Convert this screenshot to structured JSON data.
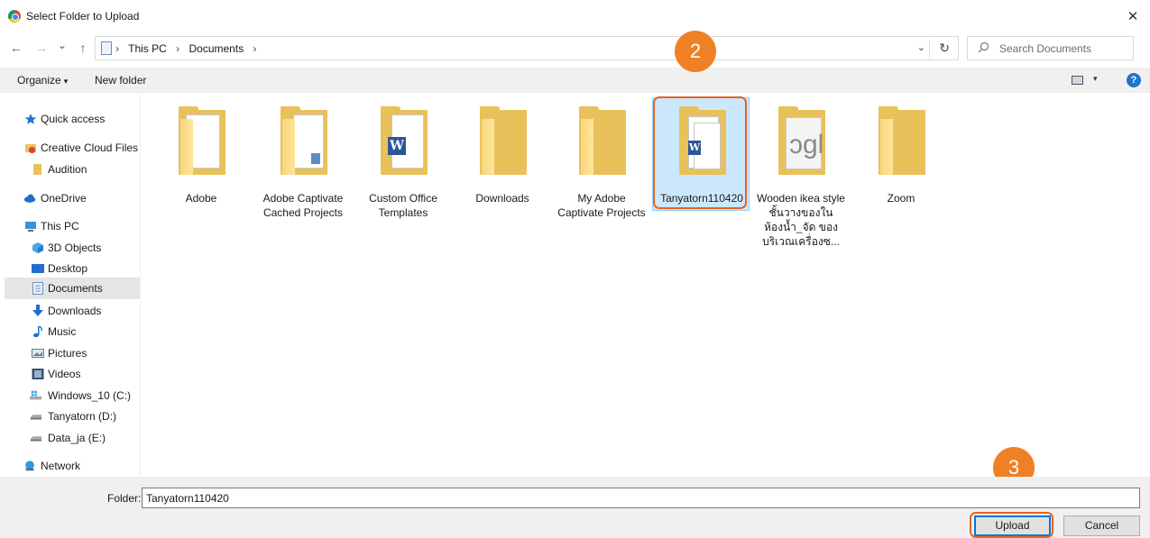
{
  "window": {
    "title": "Select Folder to Upload",
    "close_glyph": "✕"
  },
  "nav": {
    "back_glyph": "←",
    "forward_glyph": "→",
    "recent_glyph": "⌄",
    "up_glyph": "↑",
    "breadcrumbs": [
      "This PC",
      "Documents"
    ],
    "sep": "›",
    "dropdown_glyph": "⌄",
    "refresh_glyph": "↻"
  },
  "search": {
    "placeholder": "Search Documents",
    "icon": "search-icon"
  },
  "toolbar": {
    "organize": "Organize",
    "organize_caret": "▾",
    "new_folder": "New folder",
    "view_caret": "▾",
    "help": "?"
  },
  "sidebar": {
    "items": [
      {
        "label": "Quick access",
        "icon": "star-icon"
      },
      {
        "label": "Creative Cloud Files",
        "icon": "creative-cloud-icon"
      },
      {
        "label": "Audition",
        "icon": "folder-icon"
      },
      {
        "label": "OneDrive",
        "icon": "cloud-icon"
      },
      {
        "label": "This PC",
        "icon": "computer-icon"
      },
      {
        "label": "3D Objects",
        "icon": "cube-icon"
      },
      {
        "label": "Desktop",
        "icon": "desktop-icon"
      },
      {
        "label": "Documents",
        "icon": "documents-icon",
        "selected": true
      },
      {
        "label": "Downloads",
        "icon": "download-icon"
      },
      {
        "label": "Music",
        "icon": "music-icon"
      },
      {
        "label": "Pictures",
        "icon": "pictures-icon"
      },
      {
        "label": "Videos",
        "icon": "videos-icon"
      },
      {
        "label": "Windows_10 (C:)",
        "icon": "windows-drive-icon"
      },
      {
        "label": "Tanyatorn (D:)",
        "icon": "drive-icon"
      },
      {
        "label": "Data_ja (E:)",
        "icon": "drive-icon"
      },
      {
        "label": "Network",
        "icon": "network-icon"
      }
    ]
  },
  "folders": [
    {
      "name": "Adobe"
    },
    {
      "name": "Adobe Captivate Cached Projects"
    },
    {
      "name": "Custom Office Templates"
    },
    {
      "name": "Downloads"
    },
    {
      "name": "My Adobe Captivate Projects"
    },
    {
      "name": "Tanyatorn110420",
      "selected": true
    },
    {
      "name": "Wooden ikea style ชั้นวางของใน ห้องน้ำ_จัด ของบริเวณเครื่องซ..."
    },
    {
      "name": "Zoom"
    }
  ],
  "callouts": {
    "step2": "2",
    "step3": "3"
  },
  "footer": {
    "folder_label": "Folder:",
    "folder_value": "Tanyatorn110420",
    "upload": "Upload",
    "cancel": "Cancel"
  },
  "colors": {
    "accent": "#0078d7",
    "callout": "#e8631d",
    "badge": "#f08026",
    "selection": "#cce8ff",
    "folder": "#e9c15a"
  }
}
